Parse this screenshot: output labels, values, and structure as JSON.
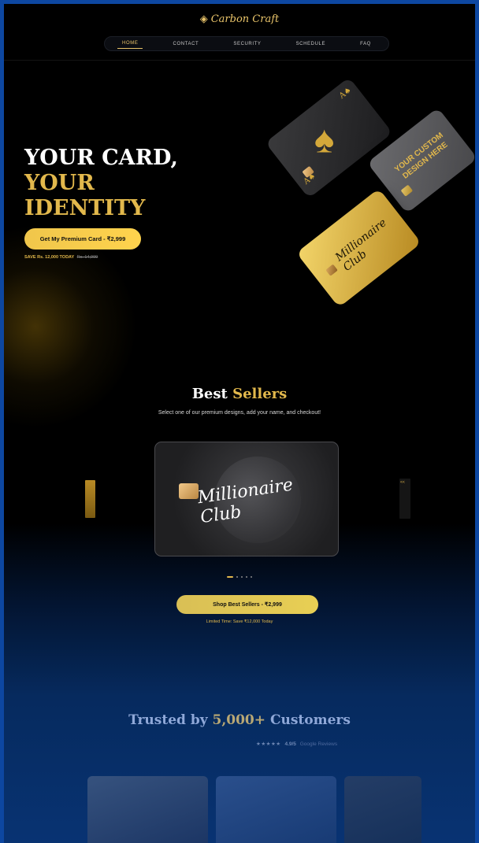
{
  "header": {
    "logo_text": "Carbon Craft",
    "nav": [
      "HOME",
      "CONTACT",
      "SECURITY",
      "SCHEDULE",
      "FAQ"
    ],
    "active_nav": "HOME"
  },
  "hero": {
    "title_line1": "YOUR CARD,",
    "title_line2": "YOUR",
    "title_line3": "IDENTITY",
    "cta_label": "Get My Premium Card - ₹2,999",
    "save_text": "SAVE Rs. 12,000 TODAY",
    "old_price": "Rs. 14,999",
    "custom_card_text": "YOUR CUSTOM DESIGN HERE",
    "signature_text": "Millionaire Club"
  },
  "best_sellers": {
    "title_part1": "Best",
    "title_part2": "Sellers",
    "subtitle": "Select one of our premium designs, add your name, and checkout!",
    "card_signature": "Millionaire Club",
    "shop_label": "Shop Best Sellers - ₹2,999",
    "limited_text": "Limited Time: Save ₹12,000 Today",
    "carousel_slides": 5,
    "active_slide": 1
  },
  "trusted": {
    "title_part1": "Trusted by",
    "title_part2": "5,000+",
    "title_part3": "Customers",
    "stars": "★★★★★",
    "score": "4.9/5",
    "source": "Google Reviews"
  },
  "colors": {
    "gold": "#e2b84c",
    "nav_active": "#e9c46a",
    "frame": "#0d47a1"
  }
}
